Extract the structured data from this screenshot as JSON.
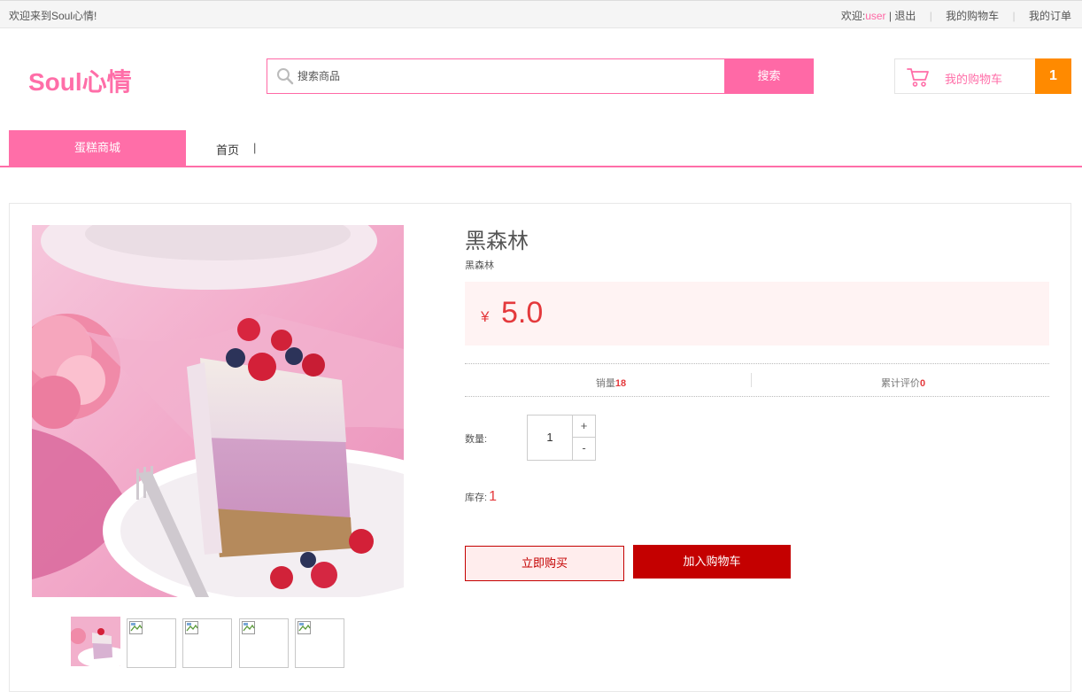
{
  "topbar": {
    "welcome": "欢迎来到Soul心情!",
    "greeting": "欢迎:",
    "username": "user",
    "logout": "| 退出",
    "my_cart": "我的购物车",
    "my_orders": "我的订单"
  },
  "header": {
    "logo": "Soul心情",
    "search_placeholder": "搜索商品",
    "search_button": "搜索",
    "cart_label": "我的购物车",
    "cart_count": "1"
  },
  "nav": {
    "category": "蛋糕商城",
    "home": "首页",
    "divider": "|"
  },
  "product": {
    "name": "黑森林",
    "subtitle": "黑森林",
    "currency": "¥",
    "price": "5.0",
    "sales_label": "销量",
    "sales": "18",
    "reviews_label": "累计评价",
    "reviews": "0",
    "quantity_label": "数量:",
    "quantity": "1",
    "plus": "+",
    "minus": "-",
    "stock_label": "库存:",
    "stock": "1",
    "buy_now": "立即购买",
    "add_to_cart": "加入购物车"
  },
  "colors": {
    "brand_pink": "#ff6ea8",
    "price_red": "#e4393c",
    "button_red": "#c40000",
    "cart_count_orange": "#ff8a00"
  },
  "icons": [
    "search-icon",
    "cart-icon",
    "broken-image-icon"
  ]
}
